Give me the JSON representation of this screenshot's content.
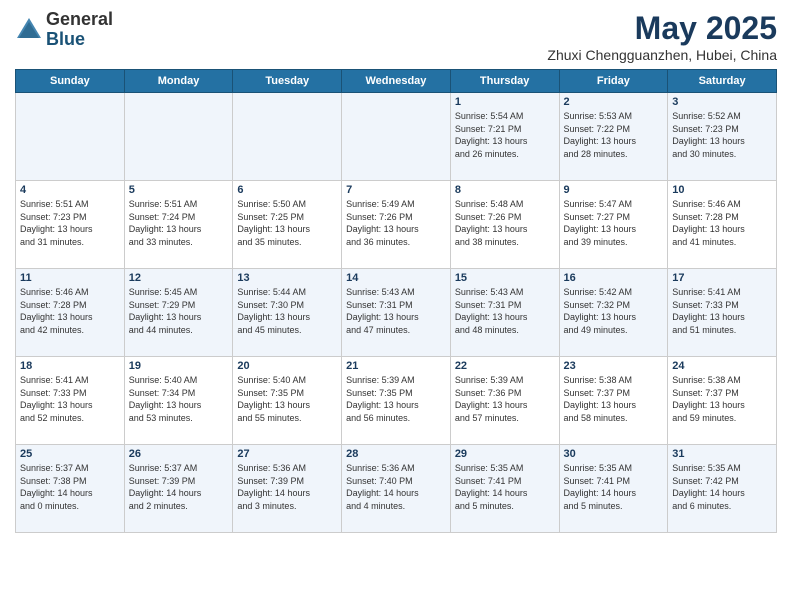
{
  "logo": {
    "general": "General",
    "blue": "Blue"
  },
  "title": "May 2025",
  "subtitle": "Zhuxi Chengguanzhen, Hubei, China",
  "days_of_week": [
    "Sunday",
    "Monday",
    "Tuesday",
    "Wednesday",
    "Thursday",
    "Friday",
    "Saturday"
  ],
  "weeks": [
    [
      {
        "day": "",
        "info": ""
      },
      {
        "day": "",
        "info": ""
      },
      {
        "day": "",
        "info": ""
      },
      {
        "day": "",
        "info": ""
      },
      {
        "day": "1",
        "info": "Sunrise: 5:54 AM\nSunset: 7:21 PM\nDaylight: 13 hours\nand 26 minutes."
      },
      {
        "day": "2",
        "info": "Sunrise: 5:53 AM\nSunset: 7:22 PM\nDaylight: 13 hours\nand 28 minutes."
      },
      {
        "day": "3",
        "info": "Sunrise: 5:52 AM\nSunset: 7:23 PM\nDaylight: 13 hours\nand 30 minutes."
      }
    ],
    [
      {
        "day": "4",
        "info": "Sunrise: 5:51 AM\nSunset: 7:23 PM\nDaylight: 13 hours\nand 31 minutes."
      },
      {
        "day": "5",
        "info": "Sunrise: 5:51 AM\nSunset: 7:24 PM\nDaylight: 13 hours\nand 33 minutes."
      },
      {
        "day": "6",
        "info": "Sunrise: 5:50 AM\nSunset: 7:25 PM\nDaylight: 13 hours\nand 35 minutes."
      },
      {
        "day": "7",
        "info": "Sunrise: 5:49 AM\nSunset: 7:26 PM\nDaylight: 13 hours\nand 36 minutes."
      },
      {
        "day": "8",
        "info": "Sunrise: 5:48 AM\nSunset: 7:26 PM\nDaylight: 13 hours\nand 38 minutes."
      },
      {
        "day": "9",
        "info": "Sunrise: 5:47 AM\nSunset: 7:27 PM\nDaylight: 13 hours\nand 39 minutes."
      },
      {
        "day": "10",
        "info": "Sunrise: 5:46 AM\nSunset: 7:28 PM\nDaylight: 13 hours\nand 41 minutes."
      }
    ],
    [
      {
        "day": "11",
        "info": "Sunrise: 5:46 AM\nSunset: 7:28 PM\nDaylight: 13 hours\nand 42 minutes."
      },
      {
        "day": "12",
        "info": "Sunrise: 5:45 AM\nSunset: 7:29 PM\nDaylight: 13 hours\nand 44 minutes."
      },
      {
        "day": "13",
        "info": "Sunrise: 5:44 AM\nSunset: 7:30 PM\nDaylight: 13 hours\nand 45 minutes."
      },
      {
        "day": "14",
        "info": "Sunrise: 5:43 AM\nSunset: 7:31 PM\nDaylight: 13 hours\nand 47 minutes."
      },
      {
        "day": "15",
        "info": "Sunrise: 5:43 AM\nSunset: 7:31 PM\nDaylight: 13 hours\nand 48 minutes."
      },
      {
        "day": "16",
        "info": "Sunrise: 5:42 AM\nSunset: 7:32 PM\nDaylight: 13 hours\nand 49 minutes."
      },
      {
        "day": "17",
        "info": "Sunrise: 5:41 AM\nSunset: 7:33 PM\nDaylight: 13 hours\nand 51 minutes."
      }
    ],
    [
      {
        "day": "18",
        "info": "Sunrise: 5:41 AM\nSunset: 7:33 PM\nDaylight: 13 hours\nand 52 minutes."
      },
      {
        "day": "19",
        "info": "Sunrise: 5:40 AM\nSunset: 7:34 PM\nDaylight: 13 hours\nand 53 minutes."
      },
      {
        "day": "20",
        "info": "Sunrise: 5:40 AM\nSunset: 7:35 PM\nDaylight: 13 hours\nand 55 minutes."
      },
      {
        "day": "21",
        "info": "Sunrise: 5:39 AM\nSunset: 7:35 PM\nDaylight: 13 hours\nand 56 minutes."
      },
      {
        "day": "22",
        "info": "Sunrise: 5:39 AM\nSunset: 7:36 PM\nDaylight: 13 hours\nand 57 minutes."
      },
      {
        "day": "23",
        "info": "Sunrise: 5:38 AM\nSunset: 7:37 PM\nDaylight: 13 hours\nand 58 minutes."
      },
      {
        "day": "24",
        "info": "Sunrise: 5:38 AM\nSunset: 7:37 PM\nDaylight: 13 hours\nand 59 minutes."
      }
    ],
    [
      {
        "day": "25",
        "info": "Sunrise: 5:37 AM\nSunset: 7:38 PM\nDaylight: 14 hours\nand 0 minutes."
      },
      {
        "day": "26",
        "info": "Sunrise: 5:37 AM\nSunset: 7:39 PM\nDaylight: 14 hours\nand 2 minutes."
      },
      {
        "day": "27",
        "info": "Sunrise: 5:36 AM\nSunset: 7:39 PM\nDaylight: 14 hours\nand 3 minutes."
      },
      {
        "day": "28",
        "info": "Sunrise: 5:36 AM\nSunset: 7:40 PM\nDaylight: 14 hours\nand 4 minutes."
      },
      {
        "day": "29",
        "info": "Sunrise: 5:35 AM\nSunset: 7:41 PM\nDaylight: 14 hours\nand 5 minutes."
      },
      {
        "day": "30",
        "info": "Sunrise: 5:35 AM\nSunset: 7:41 PM\nDaylight: 14 hours\nand 5 minutes."
      },
      {
        "day": "31",
        "info": "Sunrise: 5:35 AM\nSunset: 7:42 PM\nDaylight: 14 hours\nand 6 minutes."
      }
    ]
  ]
}
